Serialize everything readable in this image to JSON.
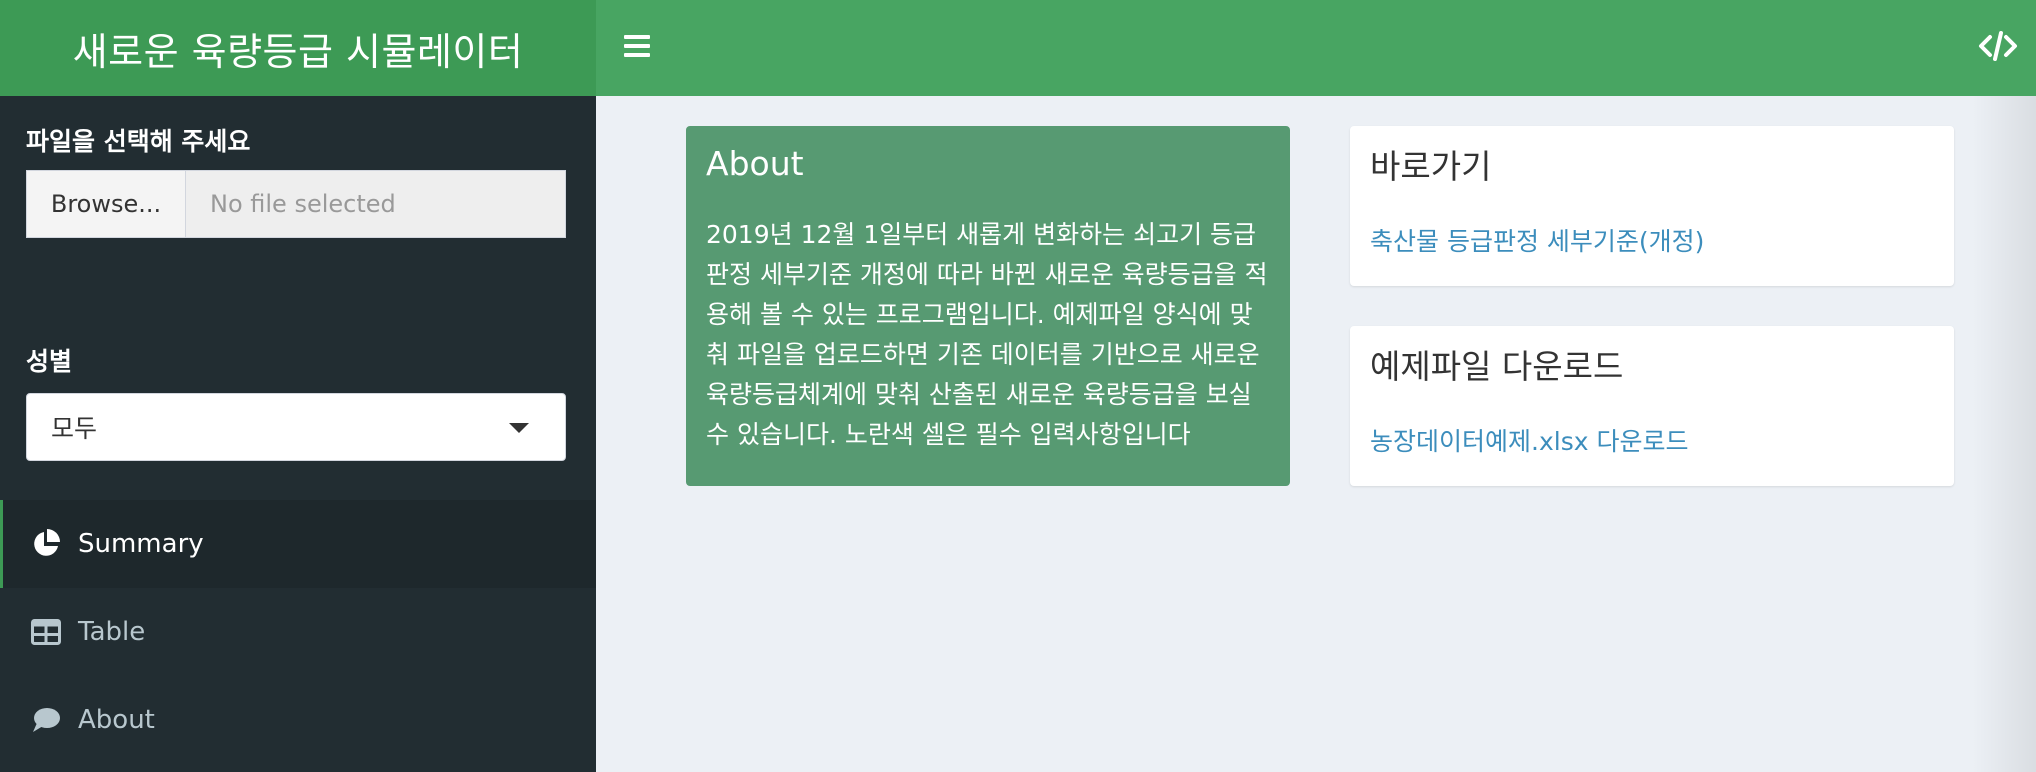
{
  "header": {
    "title": "새로운 육량등급 시뮬레이터"
  },
  "sidebar": {
    "file_label": "파일을 선택해 주세요",
    "browse_label": "Browse...",
    "file_placeholder": "No file selected",
    "gender_label": "성별",
    "gender_value": "모두",
    "menu": [
      {
        "label": "Summary",
        "icon": "pie-chart-icon"
      },
      {
        "label": "Table",
        "icon": "table-icon"
      },
      {
        "label": "About",
        "icon": "comment-icon"
      }
    ]
  },
  "about_box": {
    "title": "About",
    "body": "2019년 12월 1일부터 새롭게 변화하는 쇠고기 등급판정 세부기준 개정에 따라 바뀐 새로운 육량등급을 적용해 볼 수 있는 프로그램입니다. 예제파일 양식에 맞춰 파일을 업로드하면 기존 데이터를 기반으로 새로운 육량등급체계에 맞춰 산출된 새로운 육량등급을 보실 수 있습니다. 노란색 셀은 필수 입력사항입니다"
  },
  "shortcut_box": {
    "title": "바로가기",
    "link": "축산물 등급판정 세부기준(개정)"
  },
  "download_box": {
    "title": "예제파일 다운로드",
    "link": "농장데이터예제.xlsx 다운로드"
  },
  "colors": {
    "logo_bg": "#3d9a55",
    "navbar_bg": "#48a562",
    "sidebar_bg": "#222d32",
    "about_box_bg": "#579a72",
    "link": "#3c8dbc"
  }
}
